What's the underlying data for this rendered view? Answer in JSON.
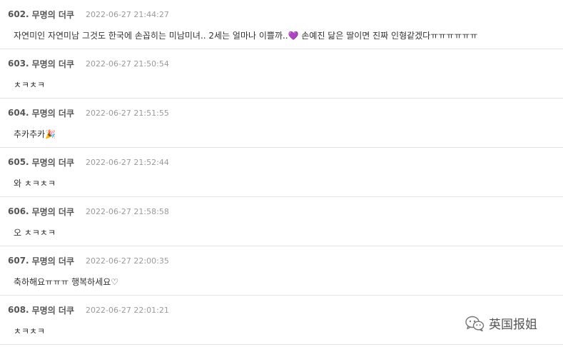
{
  "comments": [
    {
      "number": "602.",
      "author": "무명의 더쿠",
      "timestamp": "2022-06-27 21:44:27",
      "text": "자연미인 자연미남 그것도 한국에 손꼽히는 미남미녀.. 2세는 얼마나 이쁠까..💜 손예진 닮은 딸이면 진짜 인형같겠다ㅠㅠㅠㅠㅠㅠ"
    },
    {
      "number": "603.",
      "author": "무명의 더쿠",
      "timestamp": "2022-06-27 21:50:54",
      "text": "ㅊㅋㅊㅋ"
    },
    {
      "number": "604.",
      "author": "무명의 더쿠",
      "timestamp": "2022-06-27 21:51:55",
      "text": "추카추카🎉"
    },
    {
      "number": "605.",
      "author": "무명의 더쿠",
      "timestamp": "2022-06-27 21:52:44",
      "text": "와 ㅊㅋㅊㅋ"
    },
    {
      "number": "606.",
      "author": "무명의 더쿠",
      "timestamp": "2022-06-27 21:58:58",
      "text": "오 ㅊㅋㅊㅋ"
    },
    {
      "number": "607.",
      "author": "무명의 더쿠",
      "timestamp": "2022-06-27 22:00:35",
      "text": "축하해요ㅠㅠㅠ 행복하세요♡"
    },
    {
      "number": "608.",
      "author": "무명의 더쿠",
      "timestamp": "2022-06-27 22:01:21",
      "text": "ㅊㅋㅊㅋ"
    }
  ],
  "watermark": {
    "icon": "wechat-icon",
    "text": "英国报姐"
  }
}
